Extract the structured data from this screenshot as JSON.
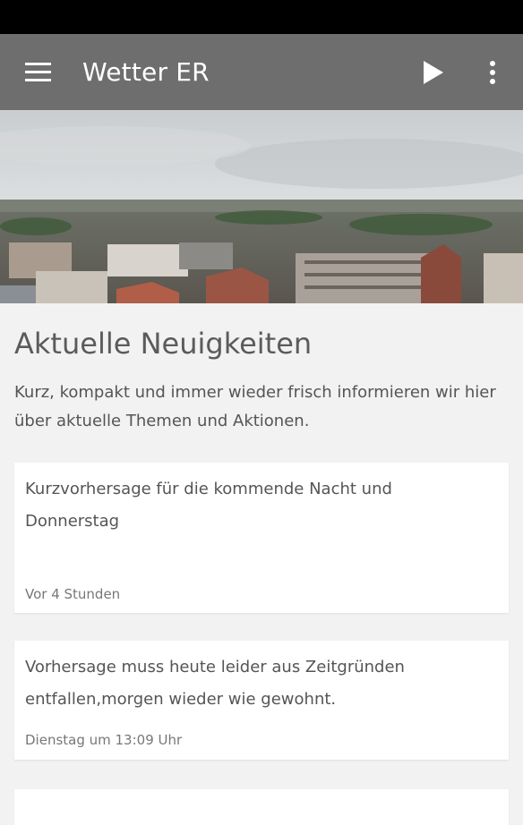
{
  "app_bar": {
    "title": "Wetter ER",
    "menu_icon": "hamburger-menu-icon",
    "play_icon": "play-icon",
    "more_icon": "more-vert-icon"
  },
  "hero": {
    "image": "city-skyline-photo"
  },
  "news": {
    "heading": "Aktuelle Neuigkeiten",
    "intro": "Kurz, kompakt und immer wieder frisch informieren wir hier über aktuelle Themen und Aktionen.",
    "items": [
      {
        "title": "Kurzvorhersage für die kommende Nacht und Donnerstag",
        "meta": "Vor 4 Stunden"
      },
      {
        "title": "Vorhersage muss heute leider aus Zeitgründen entfallen,morgen wieder wie gewohnt.",
        "meta": "Dienstag um 13:09 Uhr"
      }
    ]
  },
  "colors": {
    "app_bar": "#6e6e6e",
    "background": "#f2f2f2",
    "card": "#ffffff"
  }
}
